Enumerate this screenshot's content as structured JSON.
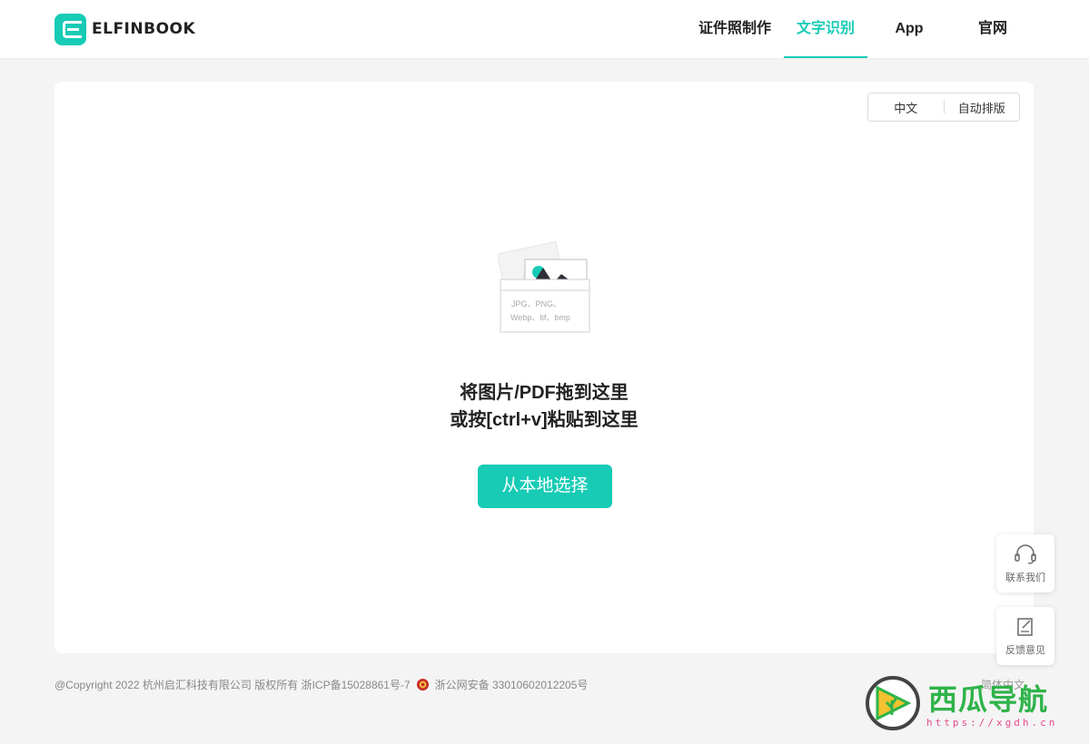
{
  "header": {
    "logo_text": "ELFINBOOK",
    "nav": [
      {
        "label": "证件照制作",
        "active": false
      },
      {
        "label": "文字识别",
        "active": true
      },
      {
        "label": "App",
        "active": false
      },
      {
        "label": "官网",
        "active": false
      }
    ]
  },
  "card": {
    "lang_toggle": {
      "option1": "中文",
      "option2": "自动排版"
    },
    "illustration": {
      "formats_line1": "JPG、PNG、",
      "formats_line2": "Webp、tif、bmp"
    },
    "drop_line1": "将图片/PDF拖到这里",
    "drop_line2": "或按[ctrl+v]粘贴到这里",
    "select_button": "从本地选择"
  },
  "float": {
    "contact": "联系我们",
    "feedback": "反馈意见"
  },
  "footer": {
    "copyright": "@Copyright 2022 杭州启汇科技有限公司 版权所有 浙ICP备15028861号-7",
    "police_record": "浙公网安备 33010602012205号",
    "language": "简体中文"
  },
  "watermark": {
    "title": "西瓜导航",
    "url": "https://xgdh.cn"
  },
  "colors": {
    "accent": "#17cbb5",
    "background": "#f4f4f4"
  }
}
